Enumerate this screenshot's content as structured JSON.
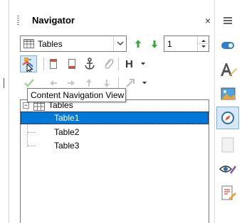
{
  "panel": {
    "title": "Navigator",
    "close_symbol": "×",
    "menu_icon": "hamburger-menu-icon"
  },
  "content_select": {
    "value": "Tables",
    "icon": "table-grid-icon"
  },
  "spin": {
    "value": "1"
  },
  "toolbar_row1": [
    "arrow-up-green-icon",
    "arrow-down-green-icon"
  ],
  "toolbar_row2": [
    "content-navigation-view-icon",
    "header-icon",
    "footer-icon",
    "anchor-icon",
    "paperclip-icon",
    "heading-levels-icon",
    "dropdown-arrow-icon"
  ],
  "toolbar_row3": [
    "checkmark-icon",
    "arrow-left-icon",
    "arrow-right-icon",
    "arrow-up-icon",
    "arrow-down-icon",
    "drag-mode-icon",
    "dropdown-arrow-icon"
  ],
  "tooltip": {
    "text": "Content Navigation View"
  },
  "tree": {
    "root": {
      "label": "Tables",
      "expander": "−"
    },
    "items": [
      {
        "label": "Table1",
        "selected": true
      },
      {
        "label": "Table2",
        "selected": false
      },
      {
        "label": "Table3",
        "selected": false
      }
    ]
  },
  "sidebar": [
    "properties-icon",
    "styles-icon",
    "gallery-icon",
    "navigator-compass-icon",
    "page-icon",
    "style-inspector-icon",
    "manage-changes-icon"
  ],
  "colors": {
    "selection": "#0078d7",
    "active_button_bg": "#d5e8f8",
    "active_button_border": "#7fb2e0",
    "green_arrow": "#3aa53a"
  }
}
